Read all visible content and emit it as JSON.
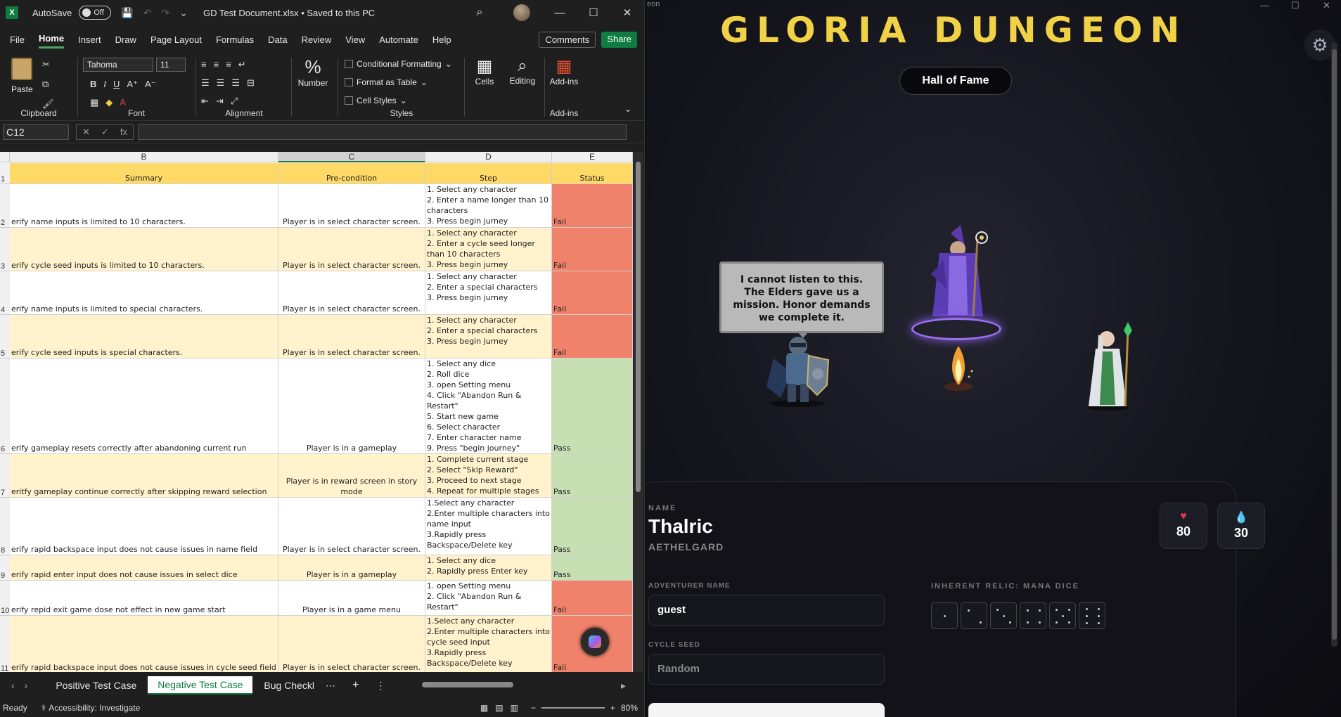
{
  "excel": {
    "autosave_label": "AutoSave",
    "autosave_state": "Off",
    "document_title": "GD Test Document.xlsx • Saved to this PC",
    "menu": [
      "File",
      "Home",
      "Insert",
      "Draw",
      "Page Layout",
      "Formulas",
      "Data",
      "Review",
      "View",
      "Automate",
      "Help"
    ],
    "menu_active": "Home",
    "comments_label": "Comments",
    "share_label": "Share",
    "ribbon": {
      "paste": "Paste",
      "clipboard": "Clipboard",
      "font_name": "Tahoma",
      "font_size": "11",
      "font": "Font",
      "alignment": "Alignment",
      "number": "Number",
      "number_icon": "%",
      "conditional_formatting": "Conditional Formatting",
      "format_as_table": "Format as Table",
      "cell_styles": "Cell Styles",
      "styles": "Styles",
      "cells": "Cells",
      "editing": "Editing",
      "addins": "Add-ins",
      "addins_group": "Add-ins"
    },
    "name_box": "C12",
    "fx": "fx",
    "columns": [
      "B",
      "C",
      "D",
      "E"
    ],
    "header_row": {
      "num": "1",
      "summary": "Summary",
      "precondition": "Pre-condition",
      "step": "Step",
      "status": "Status"
    },
    "rows": [
      {
        "num": "2",
        "summary": "erify name inputs is limited to 10 characters.",
        "precondition": "Player is in select character screen.",
        "step": "1. Select any character\n2. Enter a name longer than 10 characters\n3. Press begin jurney",
        "status": "Fail"
      },
      {
        "num": "3",
        "summary": "erify cycle seed inputs is limited to 10 characters.",
        "precondition": "Player is in select character screen.",
        "step": "1. Select any character\n2. Enter a cycle seed longer than 10 characters\n3. Press begin jurney",
        "status": "Fail"
      },
      {
        "num": "4",
        "summary": "erify name inputs is limited to special characters.",
        "precondition": "Player is in select character screen.",
        "step": "1. Select any character\n2. Enter a special characters\n3. Press begin jurney",
        "status": "Fail"
      },
      {
        "num": "5",
        "summary": "erify cycle seed inputs is special characters.",
        "precondition": "Player is in select character screen.",
        "step": "1. Select any character\n2. Enter a special characters\n3. Press begin jurney",
        "status": "Fail"
      },
      {
        "num": "6",
        "summary": "erify gameplay resets correctly after abandoning current run",
        "precondition": "Player is in a gameplay",
        "step": "1. Select any dice\n2. Roll dice\n3. open Setting menu\n4. Click \"Abandon Run & Restart\"\n5. Start new game\n6. Select character\n7. Enter character name\n9. Press \"begin journey\"",
        "status": "Pass"
      },
      {
        "num": "7",
        "summary": "eritfy gameplay continue correctly after skipping reward selection",
        "precondition": "Player is in reward screen in story mode",
        "step": "1. Complete current stage\n2. Select \"Skip Reward\"\n3. Proceed to next stage\n4. Repeat for multiple stages",
        "status": "Pass"
      },
      {
        "num": "8",
        "summary": "erify rapid backspace input does not cause issues in name field",
        "precondition": "Player is in select character screen.",
        "step": "1.Select any character\n2.Enter multiple characters into name input\n3.Rapidly press Backspace/Delete key",
        "status": "Pass"
      },
      {
        "num": "9",
        "summary": "erify rapid enter input does not cause issues in select dice",
        "precondition": "Player is in a gameplay",
        "step": "1. Select any dice\n2. Rapidly press Enter key",
        "status": "Pass"
      },
      {
        "num": "10",
        "summary": "erify repid exit game dose not effect in new game start",
        "precondition": "Player is in a game menu",
        "step": "1. open Setting menu\n2. Click \"Abandon Run & Restart\"",
        "status": "Fail"
      },
      {
        "num": "11",
        "summary": "erify rapid backspace input does not cause issues in cycle seed field",
        "precondition": "Player is in select character screen.",
        "step": "1.Select any character\n2.Enter multiple characters into cycle seed input\n3.Rapidly press Backspace/Delete key",
        "status": "Fail"
      }
    ],
    "sheets": [
      "Positive Test Case",
      "Negative Test Case",
      "Bug Checkl"
    ],
    "active_sheet": "Negative Test Case",
    "status_ready": "Ready",
    "accessibility": "Accessibility: Investigate",
    "zoom": "80%"
  },
  "game": {
    "window_title_fragment": "eon",
    "title": "GLORIA DUNGEON",
    "hall_of_fame": "Hall of Fame",
    "dialog": "I cannot listen to this. The Elders gave us a mission. Honor demands we complete it.",
    "name_label": "NAME",
    "hero_name": "Thalric",
    "hero_origin": "AETHELGARD",
    "hp": "80",
    "mana": "30",
    "adventurer_name_label": "ADVENTURER NAME",
    "adventurer_name_value": "guest",
    "cycle_seed_label": "CYCLE SEED",
    "cycle_seed_placeholder": "Random",
    "relic_label": "INHERENT RELIC: MANA DICE",
    "colors": {
      "title": "#f1d246",
      "fail": "#f0826b",
      "pass": "#c6e0b4",
      "header": "#ffd966",
      "accent": "#107c41"
    }
  }
}
